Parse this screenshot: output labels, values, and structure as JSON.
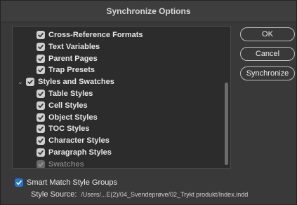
{
  "dialog": {
    "title": "Synchronize Options"
  },
  "list": {
    "items": [
      {
        "label": "Cross-Reference Formats",
        "checked": true,
        "disabled": false,
        "level": 1,
        "expandable": false
      },
      {
        "label": "Text Variables",
        "checked": true,
        "disabled": false,
        "level": 1,
        "expandable": false
      },
      {
        "label": "Parent Pages",
        "checked": true,
        "disabled": false,
        "level": 1,
        "expandable": false
      },
      {
        "label": "Trap Presets",
        "checked": true,
        "disabled": false,
        "level": 1,
        "expandable": false
      },
      {
        "label": "Styles and Swatches",
        "checked": true,
        "disabled": false,
        "level": 0,
        "expandable": true,
        "expanded": true
      },
      {
        "label": "Table Styles",
        "checked": true,
        "disabled": false,
        "level": 1,
        "expandable": false
      },
      {
        "label": "Cell Styles",
        "checked": true,
        "disabled": false,
        "level": 1,
        "expandable": false
      },
      {
        "label": "Object Styles",
        "checked": true,
        "disabled": false,
        "level": 1,
        "expandable": false
      },
      {
        "label": "TOC Styles",
        "checked": true,
        "disabled": false,
        "level": 1,
        "expandable": false
      },
      {
        "label": "Character Styles",
        "checked": true,
        "disabled": false,
        "level": 1,
        "expandable": false
      },
      {
        "label": "Paragraph Styles",
        "checked": true,
        "disabled": false,
        "level": 1,
        "expandable": false
      },
      {
        "label": "Swatches",
        "checked": true,
        "disabled": true,
        "level": 1,
        "expandable": false
      }
    ]
  },
  "buttons": {
    "ok": "OK",
    "cancel": "Cancel",
    "synchronize": "Synchronize"
  },
  "smart_match": {
    "label": "Smart Match Style Groups",
    "checked": true
  },
  "style_source": {
    "label": "Style Source:",
    "path": "/Users/...E(2)/04_Svendeprøve/02_Trykt produkt/Index.indd"
  },
  "colors": {
    "accent": "#1e78d6",
    "background": "#393939",
    "list_background": "#2c2c2c"
  },
  "icons": {
    "checkbox": "checkmark-icon",
    "expander": "chevron-down-icon"
  }
}
